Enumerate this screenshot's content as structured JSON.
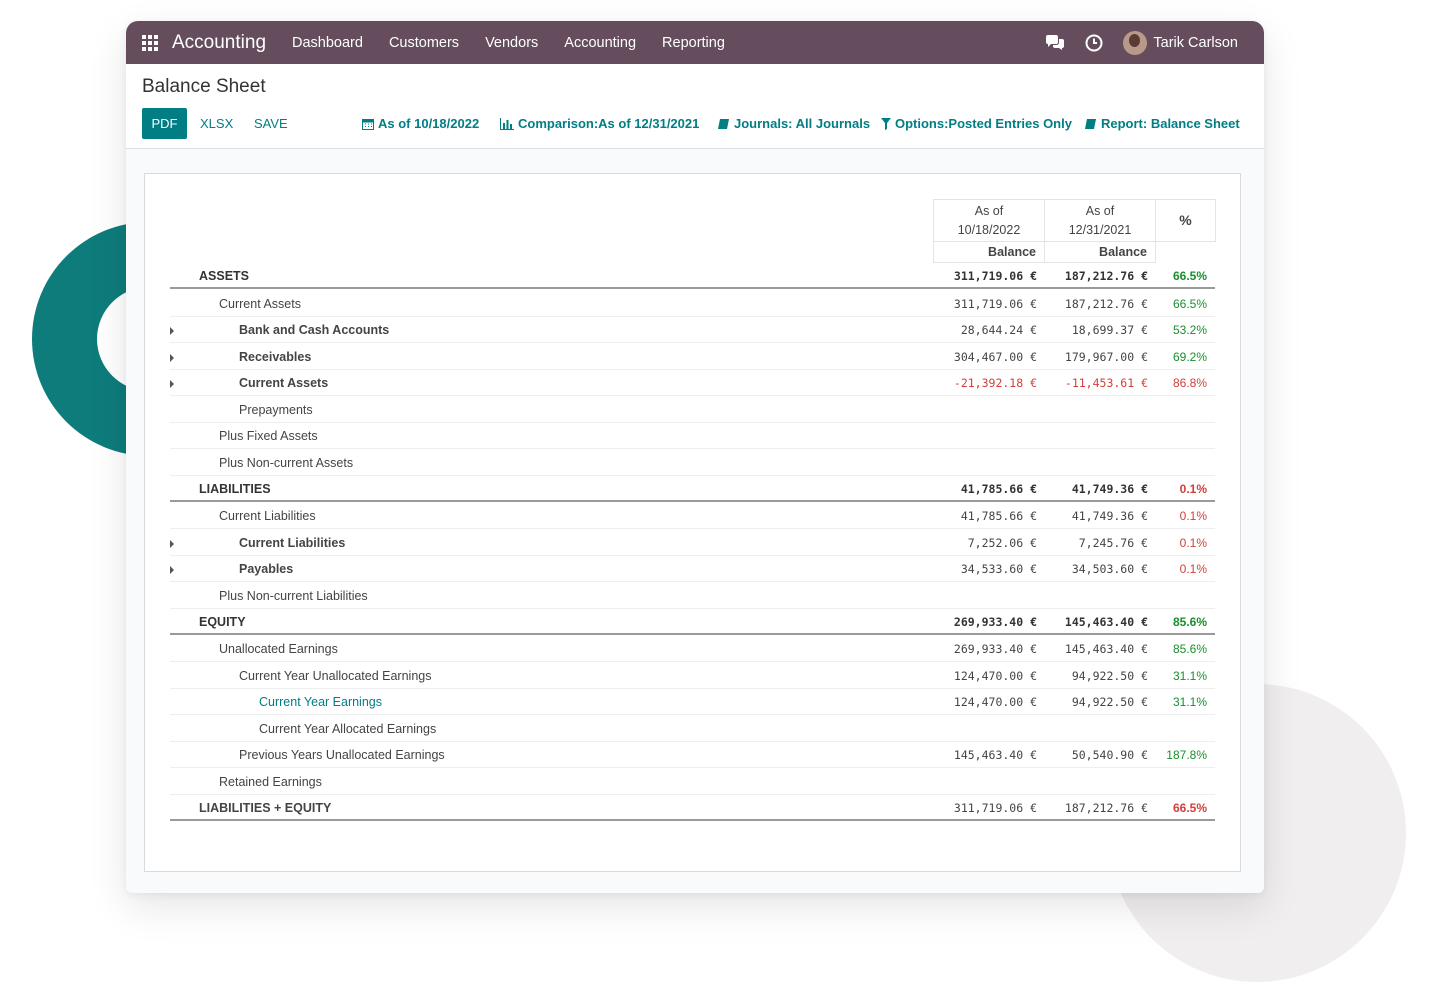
{
  "navbar": {
    "app_name": "Accounting",
    "items": [
      {
        "label": "Dashboard"
      },
      {
        "label": "Customers"
      },
      {
        "label": "Vendors"
      },
      {
        "label": "Accounting"
      },
      {
        "label": "Reporting"
      }
    ],
    "user_name": "Tarik Carlson",
    "color": "#654d5e"
  },
  "page": {
    "title": "Balance Sheet"
  },
  "toolbar": {
    "pdf_label": "PDF",
    "xlsx_label": "XLSX",
    "save_label": "SAVE",
    "filters": {
      "as_of": "As of 10/18/2022",
      "comparison": "Comparison:As of 12/31/2021",
      "journals": "Journals: All Journals",
      "options": "Options:Posted Entries Only",
      "report": "Report: Balance Sheet"
    },
    "accent": "#017e84"
  },
  "table": {
    "headers": {
      "col1_line1": "As of",
      "col1_line2": "10/18/2022",
      "col2_line1": "As of",
      "col2_line2": "12/31/2021",
      "pct": "%",
      "balance1": "Balance",
      "balance2": "Balance"
    },
    "rows": {
      "assets": {
        "label": "ASSETS",
        "a": "311,719.06 €",
        "b": "187,212.76 €",
        "pct": "66.5%"
      },
      "current_assets_group": {
        "label": "Current Assets",
        "a": "311,719.06 €",
        "b": "187,212.76 €",
        "pct": "66.5%"
      },
      "bank_cash": {
        "label": "Bank and Cash Accounts",
        "a": "28,644.24 €",
        "b": "18,699.37 €",
        "pct": "53.2%"
      },
      "receivables": {
        "label": "Receivables",
        "a": "304,467.00 €",
        "b": "179,967.00 €",
        "pct": "69.2%"
      },
      "current_assets": {
        "label": "Current Assets",
        "a": "-21,392.18 €",
        "b": "-11,453.61 €",
        "pct": "86.8%"
      },
      "prepayments": {
        "label": "Prepayments"
      },
      "fixed_assets": {
        "label": "Plus Fixed Assets"
      },
      "noncurrent_assets": {
        "label": "Plus Non-current Assets"
      },
      "liabilities": {
        "label": "LIABILITIES",
        "a": "41,785.66 €",
        "b": "41,749.36 €",
        "pct": "0.1%"
      },
      "current_liabilities_group": {
        "label": "Current Liabilities",
        "a": "41,785.66 €",
        "b": "41,749.36 €",
        "pct": "0.1%"
      },
      "current_liabilities": {
        "label": "Current Liabilities",
        "a": "7,252.06 €",
        "b": "7,245.76 €",
        "pct": "0.1%"
      },
      "payables": {
        "label": "Payables",
        "a": "34,533.60 €",
        "b": "34,503.60 €",
        "pct": "0.1%"
      },
      "noncurrent_liabilities": {
        "label": "Plus Non-current Liabilities"
      },
      "equity": {
        "label": "EQUITY",
        "a": "269,933.40 €",
        "b": "145,463.40 €",
        "pct": "85.6%"
      },
      "unallocated": {
        "label": "Unallocated Earnings",
        "a": "269,933.40 €",
        "b": "145,463.40 €",
        "pct": "85.6%"
      },
      "cy_unallocated": {
        "label": "Current Year Unallocated Earnings",
        "a": "124,470.00 €",
        "b": "94,922.50 €",
        "pct": "31.1%"
      },
      "cy_earnings": {
        "label": "Current Year Earnings",
        "a": "124,470.00 €",
        "b": "94,922.50 €",
        "pct": "31.1%"
      },
      "cy_allocated": {
        "label": "Current Year Allocated Earnings"
      },
      "py_unallocated": {
        "label": "Previous Years Unallocated Earnings",
        "a": "145,463.40 €",
        "b": "50,540.90 €",
        "pct": "187.8%"
      },
      "retained": {
        "label": "Retained Earnings"
      },
      "liab_equity": {
        "label": "LIABILITIES + EQUITY",
        "a": "311,719.06 €",
        "b": "187,212.76 €",
        "pct": "66.5%"
      }
    }
  }
}
